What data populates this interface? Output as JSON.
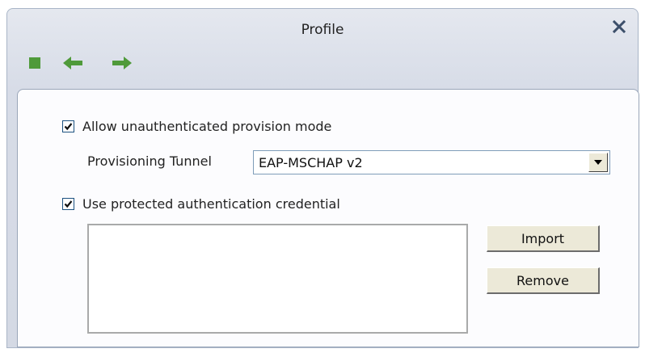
{
  "window": {
    "title": "Profile"
  },
  "toolbar": {
    "icons": [
      "stop-square-icon",
      "back-arrow-icon",
      "forward-arrow-icon",
      "close-icon"
    ],
    "accent_color": "#4f9a3a"
  },
  "form": {
    "allow_unauth": {
      "label": "Allow unauthenticated provision mode",
      "checked": true
    },
    "provisioning_tunnel": {
      "label": "Provisioning Tunnel",
      "value": "EAP-MSCHAP v2"
    },
    "protected_credential": {
      "label": "Use protected authentication credential",
      "checked": true
    },
    "buttons": {
      "import": "Import",
      "remove": "Remove"
    }
  }
}
